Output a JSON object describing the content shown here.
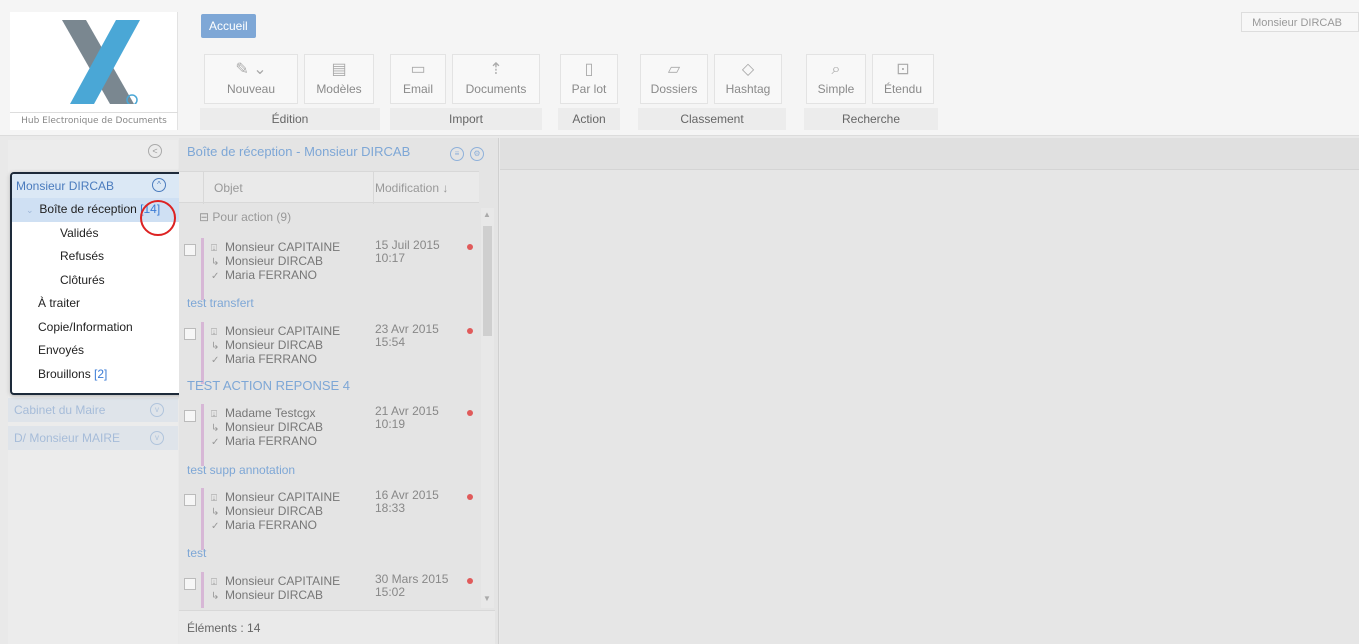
{
  "header": {
    "logo_sub": "Hub Electronique de Documents",
    "tab_label": "Accueil",
    "user_label": "Monsieur DIRCAB"
  },
  "ribbon": {
    "groups": [
      {
        "label": "Édition",
        "buttons": [
          {
            "label": "Nouveau",
            "icon": "edit-icon"
          },
          {
            "label": "Modèles",
            "icon": "template-icon"
          }
        ]
      },
      {
        "label": "Import",
        "buttons": [
          {
            "label": "Email",
            "icon": "email-icon"
          },
          {
            "label": "Documents",
            "icon": "document-upload-icon"
          }
        ]
      },
      {
        "label": "Action",
        "buttons": [
          {
            "label": "Par lot",
            "icon": "batch-icon"
          }
        ]
      },
      {
        "label": "Classement",
        "buttons": [
          {
            "label": "Dossiers",
            "icon": "folder-icon"
          },
          {
            "label": "Hashtag",
            "icon": "tag-icon"
          }
        ]
      },
      {
        "label": "Recherche",
        "buttons": [
          {
            "label": "Simple",
            "icon": "search-icon"
          },
          {
            "label": "Étendu",
            "icon": "advanced-search-icon"
          }
        ]
      }
    ]
  },
  "nav": {
    "user": "Monsieur DIRCAB",
    "items": [
      {
        "label": "Boîte de réception",
        "count": "[14]"
      },
      {
        "label": "Validés",
        "count": ""
      },
      {
        "label": "Refusés",
        "count": ""
      },
      {
        "label": "Clôturés",
        "count": ""
      },
      {
        "label": "À traiter",
        "count": ""
      },
      {
        "label": "Copie/Information",
        "count": ""
      },
      {
        "label": "Envoyés",
        "count": ""
      },
      {
        "label": "Brouillons",
        "count": "[2]"
      }
    ],
    "groups": [
      "Cabinet du Maire",
      "D/ Monsieur MAIRE"
    ]
  },
  "list": {
    "title": "Boîte de réception - Monsieur DIRCAB",
    "col_objet": "Objet",
    "col_modification": "Modification ↓",
    "group": "Pour action (9)",
    "messages": [
      {
        "from": "Monsieur CAPITAINE",
        "to": "Monsieur DIRCAB",
        "via": "Maria FERRANO",
        "date": "15 Juil 2015",
        "time": "10:17",
        "subject": "test transfert"
      },
      {
        "from": "Monsieur CAPITAINE",
        "to": "Monsieur DIRCAB",
        "via": "Maria FERRANO",
        "date": "23 Avr 2015",
        "time": "15:54",
        "subject": "TEST ACTION REPONSE 4"
      },
      {
        "from": "Madame Testcgx",
        "to": "Monsieur DIRCAB",
        "via": "Maria FERRANO",
        "date": "21 Avr 2015",
        "time": "10:19",
        "subject": "test supp annotation"
      },
      {
        "from": "Monsieur CAPITAINE",
        "to": "Monsieur DIRCAB",
        "via": "Maria FERRANO",
        "date": "16 Avr 2015",
        "time": "18:33",
        "subject": "test"
      },
      {
        "from": "Monsieur CAPITAINE",
        "to": "Monsieur DIRCAB",
        "via": "",
        "date": "30 Mars 2015",
        "time": "15:02",
        "subject": ""
      }
    ],
    "footer": "Éléments : 14"
  }
}
